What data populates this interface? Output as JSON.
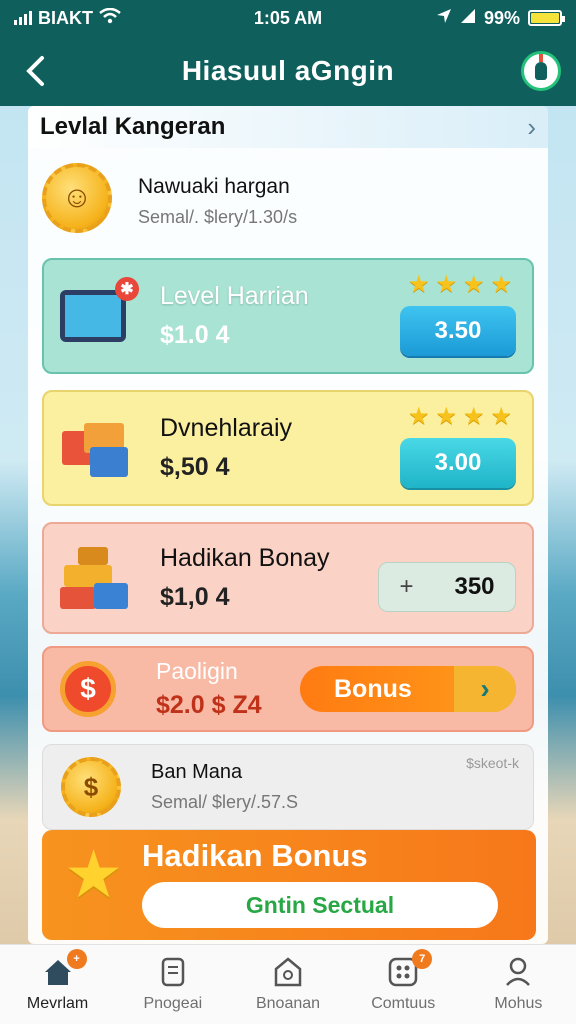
{
  "status_bar": {
    "carrier": "BIAKT",
    "time": "1:05 AM",
    "battery": "99%"
  },
  "header": {
    "title": "Hiasuul aGngin",
    "back_icon": "chevron-left-icon",
    "action_icon": "bottle-icon"
  },
  "section": {
    "title": "Levlal Kangeran"
  },
  "rows": [
    {
      "name": "Nawuaki hargan",
      "sub": "Semal/. $lery/1.30/s",
      "icon": "sun-gear-icon"
    }
  ],
  "cards": [
    {
      "name": "Level Harrian",
      "price": "$1.0 4",
      "button": "3.50",
      "stars": 4,
      "icon": "tablet-icon"
    },
    {
      "name": "Dvnehlaraiy",
      "price": "$,50 4",
      "button": "3.00",
      "stars": 4,
      "icon": "gift-boxes-icon"
    },
    {
      "name": "Hadikan Bonay",
      "price": "$1,0 4",
      "button_prefix": "+",
      "button": "350",
      "icon": "treasure-boxes-icon"
    },
    {
      "name": "Paoligin",
      "price": "$2.0 $ Z4",
      "button": "Bonus",
      "icon": "dollar-coin-icon"
    },
    {
      "name": "Ban Mana",
      "sub": "Semal/ $lery/.57.S",
      "tag": "$skeot-k",
      "icon": "dollar-gear-icon"
    }
  ],
  "banner": {
    "title": "Hadikan Bonus",
    "cta": "Gntin Sectual"
  },
  "tabs": [
    {
      "label": "Mevrlam",
      "badge": "+",
      "icon": "home-icon",
      "active": true
    },
    {
      "label": "Pnogeai",
      "icon": "document-icon"
    },
    {
      "label": "Bnoanan",
      "icon": "chat-icon"
    },
    {
      "label": "Comtuus",
      "badge": "7",
      "icon": "grid-icon"
    },
    {
      "label": "Mohus",
      "icon": "profile-icon"
    }
  ],
  "colors": {
    "header": "#0f5f5c",
    "accent_orange": "#f7931e",
    "star": "#f6c21b"
  }
}
